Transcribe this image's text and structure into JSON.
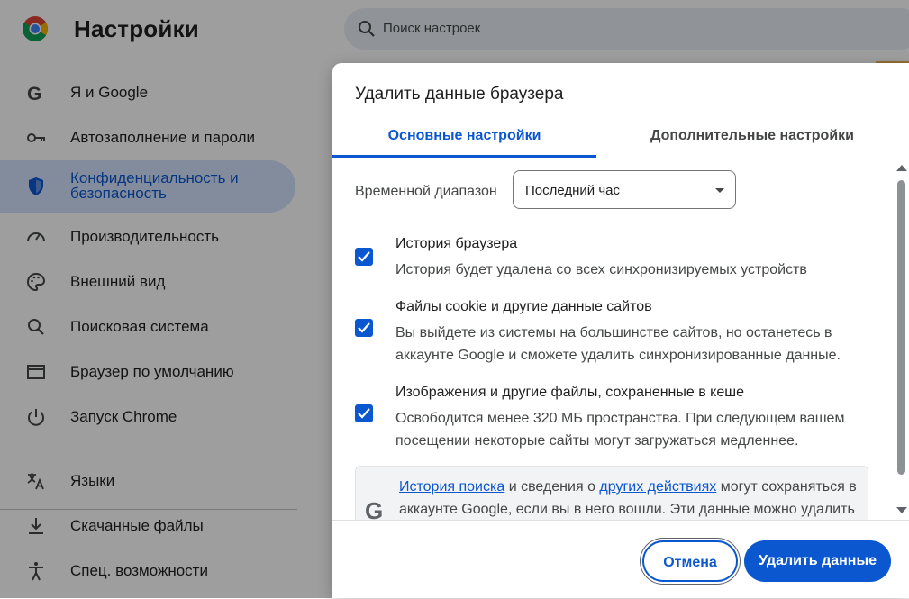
{
  "app": {
    "title": "Настройки",
    "search_placeholder": "Поиск настроек"
  },
  "sidebar": {
    "items": [
      {
        "label": "Я и Google",
        "icon": "google-icon"
      },
      {
        "label": "Автозаполнение и пароли",
        "icon": "key-icon"
      },
      {
        "label": "Конфиденциальность и безопасность",
        "icon": "shield-icon",
        "active": true
      },
      {
        "label": "Производительность",
        "icon": "speedometer-icon"
      },
      {
        "label": "Внешний вид",
        "icon": "palette-icon"
      },
      {
        "label": "Поисковая система",
        "icon": "search-icon"
      },
      {
        "label": "Браузер по умолчанию",
        "icon": "browser-window-icon"
      },
      {
        "label": "Запуск Chrome",
        "icon": "power-icon"
      },
      {
        "label": "Языки",
        "icon": "translate-icon"
      },
      {
        "label": "Скачанные файлы",
        "icon": "download-icon"
      },
      {
        "label": "Спец. возможности",
        "icon": "accessibility-icon"
      }
    ]
  },
  "dialog": {
    "title": "Удалить данные браузера",
    "tabs": [
      {
        "label": "Основные настройки",
        "selected": true
      },
      {
        "label": "Дополнительные настройки",
        "selected": false
      }
    ],
    "time_range": {
      "label": "Временной диапазон",
      "value": "Последний час"
    },
    "options": [
      {
        "title": "История браузера",
        "description": "История будет удалена со всех синхронизируемых устройств",
        "checked": true
      },
      {
        "title": "Файлы cookie и другие данные сайтов",
        "description": "Вы выйдете из системы на большинстве сайтов, но останетесь в аккаунте Google и сможете удалить синхронизированные данные.",
        "checked": true
      },
      {
        "title": "Изображения и другие файлы, сохраненные в кеше",
        "description": "Освободится менее 320 МБ пространства. При следующем вашем посещении некоторые сайты могут загружаться медленнее.",
        "checked": true
      }
    ],
    "info": {
      "link1": "История поиска",
      "text1": " и сведения о ",
      "link2": "других действиях",
      "text2": " могут сохраняться в аккаунте Google, если вы в него вошли. Эти данные можно удалить"
    },
    "buttons": {
      "cancel": "Отмена",
      "delete": "Удалить данные"
    }
  },
  "colors": {
    "accent": "#0b57d0",
    "active_nav_bg": "#d3e3fd"
  }
}
